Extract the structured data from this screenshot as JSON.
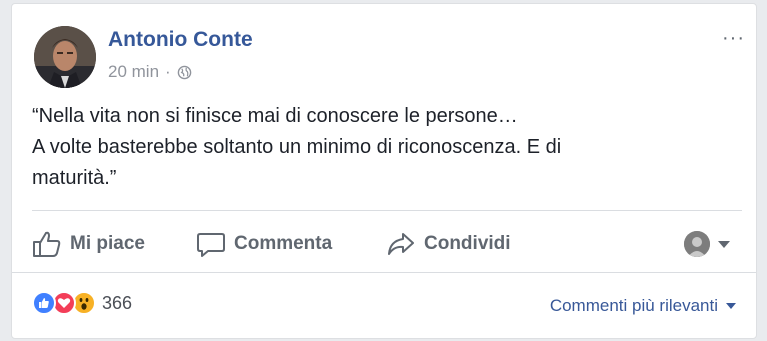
{
  "post": {
    "author": "Antonio Conte",
    "time": "20 min",
    "separator": "·",
    "audience_icon": "globe-icon",
    "options_label": "···",
    "text_lines": [
      "“Nella vita non si finisce mai di conoscere le persone…",
      "A volte basterebbe soltanto un minimo di riconoscenza. E di",
      "maturità.”"
    ]
  },
  "actions": {
    "like": {
      "label": "Mi piace",
      "icon": "thumbs-up-icon"
    },
    "comment": {
      "label": "Commenta",
      "icon": "comment-bubble-icon"
    },
    "share": {
      "label": "Condividi",
      "icon": "share-arrow-icon"
    }
  },
  "reactions": {
    "icons": [
      "like-reaction-icon",
      "love-reaction-icon",
      "wow-reaction-icon"
    ],
    "count": "366"
  },
  "comments_sort": {
    "label": "Commenti più rilevanti"
  },
  "colors": {
    "author": "#365899",
    "secondary_text": "#90949c",
    "action_text": "#606770",
    "like_blue": "#4080ff",
    "love_red": "#f33e58",
    "wow_yellow": "#f7b125"
  }
}
